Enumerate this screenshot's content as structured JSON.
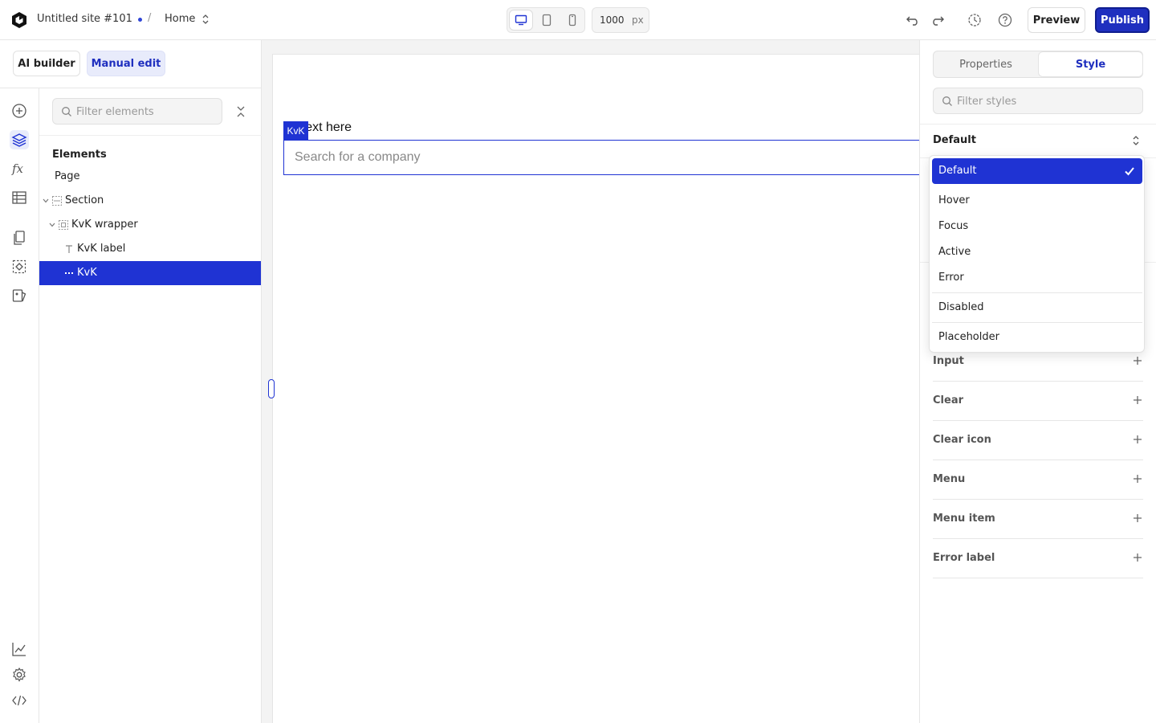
{
  "header": {
    "site_name": "Untitled site #101",
    "breadcrumb_sep": "/",
    "page_name": "Home",
    "canvas_width": "1000",
    "canvas_width_unit": "px",
    "preview_label": "Preview",
    "publish_label": "Publish"
  },
  "left_header": {
    "ai_builder": "AI builder",
    "manual_edit": "Manual edit"
  },
  "elements_panel": {
    "filter_placeholder": "Filter elements",
    "title": "Elements",
    "tree": [
      {
        "label": "Page",
        "icon": "none"
      },
      {
        "label": "Section",
        "icon": "section-icon"
      },
      {
        "label": "KvK wrapper",
        "icon": "wrapper-icon"
      },
      {
        "label": "KvK label",
        "icon": "text-icon"
      },
      {
        "label": "KvK",
        "icon": "input-icon",
        "selected": true
      }
    ]
  },
  "canvas": {
    "selected_tag": "KvK",
    "label_text": "r text here",
    "input_placeholder": "Search for a company"
  },
  "right_panel": {
    "tabs": [
      "Properties",
      "Style"
    ],
    "active_tab": "Style",
    "filter_placeholder": "Filter styles",
    "state_value": "Default",
    "sections": [
      "Input",
      "Clear",
      "Clear icon",
      "Menu",
      "Menu item",
      "Error label"
    ]
  },
  "state_dropdown": {
    "options": [
      "Default",
      "Hover",
      "Focus",
      "Active",
      "Error",
      "Disabled",
      "Placeholder"
    ],
    "selected": "Default"
  },
  "colors": {
    "accent": "#1f33d3",
    "publish_bg": "#1f2fbf",
    "accent_soft": "#e8ebfb"
  }
}
